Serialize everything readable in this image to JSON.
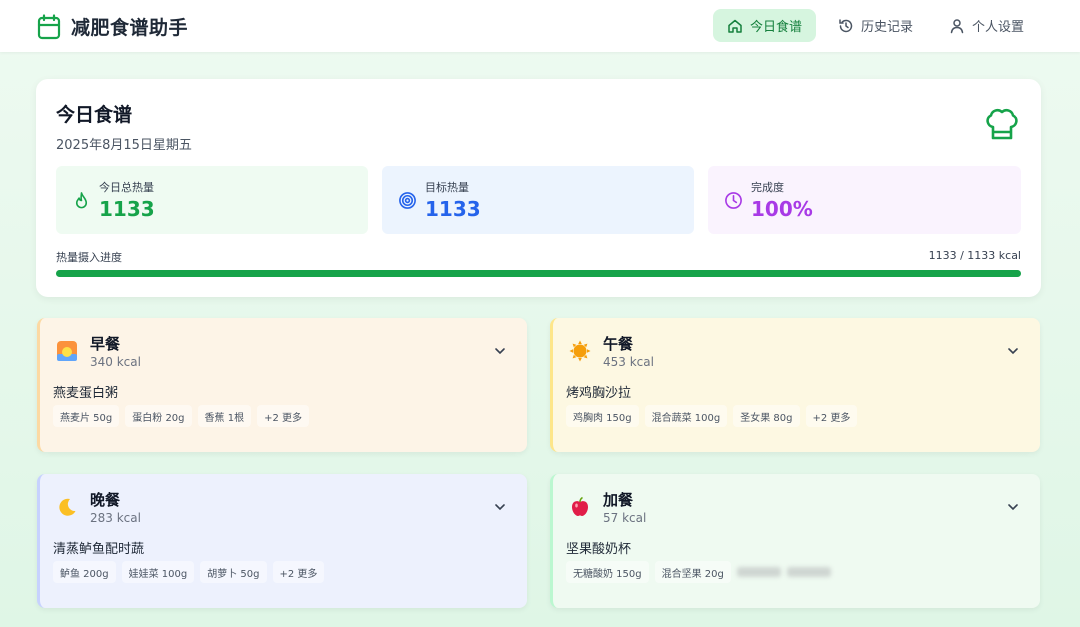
{
  "app": {
    "title": "减肥食谱助手"
  },
  "nav": [
    {
      "label": "今日食谱",
      "icon": "home-icon",
      "active": true
    },
    {
      "label": "历史记录",
      "icon": "history-icon",
      "active": false
    },
    {
      "label": "个人设置",
      "icon": "user-icon",
      "active": false
    }
  ],
  "summary": {
    "title": "今日食谱",
    "date": "2025年8月15日星期五",
    "stats": [
      {
        "label": "今日总热量",
        "value": "1133",
        "icon": "flame-icon",
        "color": "#16a34a"
      },
      {
        "label": "目标热量",
        "value": "1133",
        "icon": "target-icon",
        "color": "#2563eb"
      },
      {
        "label": "完成度",
        "value": "100%",
        "icon": "clock-icon",
        "color": "#a83ae6"
      }
    ],
    "progress_label": "热量摄入进度",
    "progress_text": "1133 / 1133 kcal",
    "progress_fraction": 1.0
  },
  "meals": [
    {
      "name": "早餐",
      "kcal": "340 kcal",
      "dish": "燕麦蛋白粥",
      "icon": "sunrise-icon",
      "tags": [
        "燕麦片 50g",
        "蛋白粉 20g",
        "香蕉 1根",
        "+2 更多"
      ]
    },
    {
      "name": "午餐",
      "kcal": "453 kcal",
      "dish": "烤鸡胸沙拉",
      "icon": "sun-icon",
      "tags": [
        "鸡胸肉 150g",
        "混合蔬菜 100g",
        "圣女果 80g",
        "+2 更多"
      ]
    },
    {
      "name": "晚餐",
      "kcal": "283 kcal",
      "dish": "清蒸鲈鱼配时蔬",
      "icon": "moon-icon",
      "tags": [
        "鲈鱼 200g",
        "娃娃菜 100g",
        "胡萝卜 50g",
        "+2 更多"
      ]
    },
    {
      "name": "加餐",
      "kcal": "57 kcal",
      "dish": "坚果酸奶杯",
      "icon": "apple-icon",
      "tags": [
        "无糖酸奶 150g",
        "混合坚果 20g"
      ]
    }
  ]
}
